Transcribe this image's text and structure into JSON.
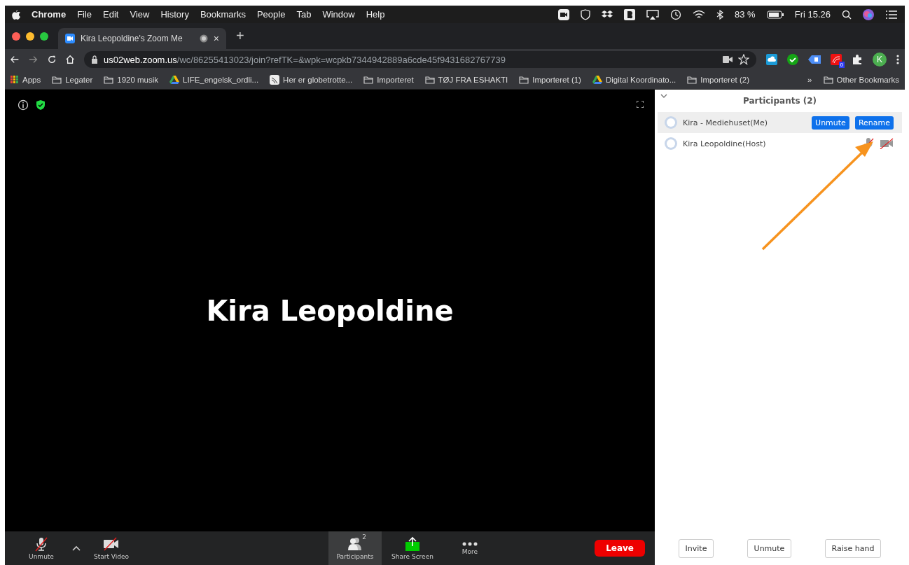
{
  "menubar": {
    "app": "Chrome",
    "menus": [
      "File",
      "Edit",
      "View",
      "History",
      "Bookmarks",
      "People",
      "Tab",
      "Window",
      "Help"
    ],
    "battery": "83 %",
    "clock": "Fri 15.26"
  },
  "tab": {
    "title": "Kira Leopoldine's Zoom Me",
    "close": "×",
    "new_tab": "+"
  },
  "address": {
    "host": "us02web.zoom.us",
    "path": "/wc/86255413023/join?refTK=&wpk=wcpkb7344942889a6cde45f9431682767739"
  },
  "extensions": {
    "badge": "0",
    "profile": "K"
  },
  "bookmarks": [
    {
      "label": "Apps",
      "kind": "apps"
    },
    {
      "label": "Legater",
      "kind": "folder"
    },
    {
      "label": "1920 musik",
      "kind": "folder"
    },
    {
      "label": "LIFE_engelsk_ordli...",
      "kind": "drive"
    },
    {
      "label": "Her er globetrotte...",
      "kind": "site"
    },
    {
      "label": "Importeret",
      "kind": "folder"
    },
    {
      "label": "TØJ FRA ESHAKTI",
      "kind": "folder"
    },
    {
      "label": "Importeret (1)",
      "kind": "folder"
    },
    {
      "label": "Digital Koordinato...",
      "kind": "drive"
    },
    {
      "label": "Importeret (2)",
      "kind": "folder"
    }
  ],
  "bookmarks_overflow": "»",
  "other_bookmarks": "Other Bookmarks",
  "video": {
    "speaker": "Kira Leopoldine"
  },
  "toolbar": {
    "items": [
      {
        "label": "Unmute",
        "kind": "mic"
      },
      {
        "label": "Start Video",
        "kind": "video"
      },
      {
        "label": "Participants",
        "kind": "participants",
        "count": "2",
        "selected": true
      },
      {
        "label": "Share Screen",
        "kind": "share",
        "selected": false
      },
      {
        "label": "More",
        "kind": "more",
        "selected": false
      }
    ],
    "leave": "Leave"
  },
  "panel": {
    "title": "Participants (2)",
    "participants": [
      {
        "name": "Kira - Mediehuset(Me)",
        "selected": true,
        "actions": [
          "Unmute",
          "Rename"
        ]
      },
      {
        "name": "Kira Leopoldine(Host)",
        "selected": false,
        "audio_muted": true,
        "video_off": true
      }
    ],
    "footer": [
      "Invite",
      "Unmute",
      "Raise hand"
    ]
  }
}
